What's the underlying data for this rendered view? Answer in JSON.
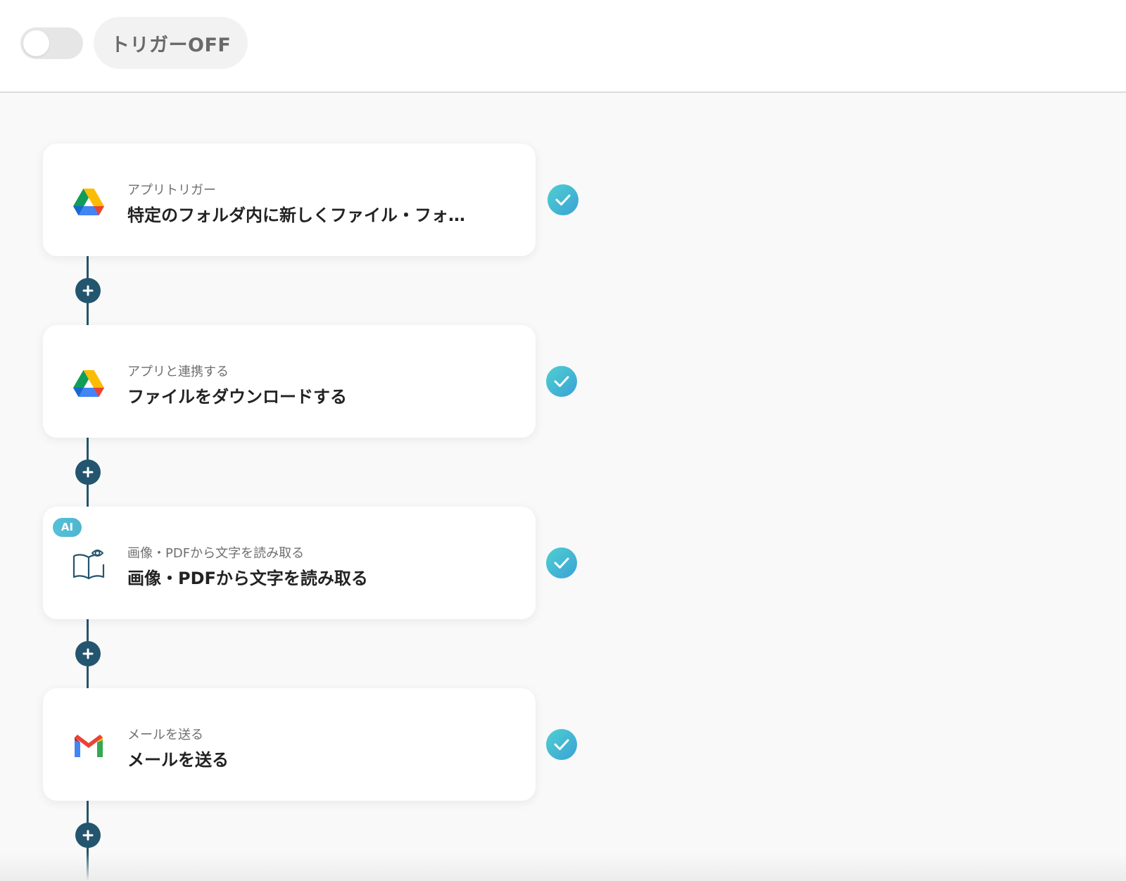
{
  "header": {
    "trigger_toggle_state": "off",
    "trigger_label": "トリガーOFF"
  },
  "colors": {
    "flow_line": "#24556e",
    "check_gradient": [
      "#4fd0d0",
      "#3aa1d6"
    ],
    "ai_badge": "#55c1d9"
  },
  "steps": [
    {
      "icon": "google-drive-icon",
      "kicker": "アプリトリガー",
      "title": "特定のフォルダ内に新しくファイル・フォ…",
      "status": "completed"
    },
    {
      "icon": "google-drive-icon",
      "kicker": "アプリと連携する",
      "title": "ファイルをダウンロードする",
      "status": "completed"
    },
    {
      "icon": "ocr-book-icon",
      "badge": "AI",
      "kicker": "画像・PDFから文字を読み取る",
      "title": "画像・PDFから文字を読み取る",
      "status": "completed"
    },
    {
      "icon": "gmail-icon",
      "kicker": "メールを送る",
      "title": "メールを送る",
      "status": "completed"
    }
  ]
}
